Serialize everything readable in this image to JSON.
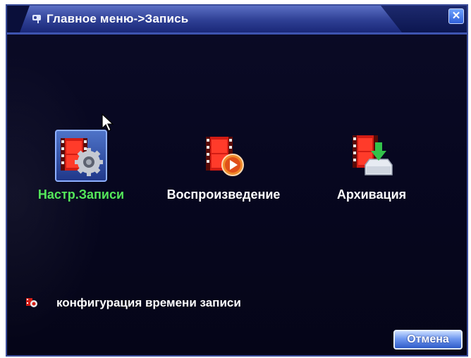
{
  "window": {
    "title": "Главное меню->Запись",
    "close_symbol": "✕"
  },
  "menu": {
    "items": [
      {
        "label": "Настр.Записи",
        "icon": "record-settings-icon",
        "selected": true
      },
      {
        "label": "Воспроизведение",
        "icon": "playback-icon",
        "selected": false
      },
      {
        "label": "Архивация",
        "icon": "backup-icon",
        "selected": false
      }
    ]
  },
  "hint": {
    "text": "конфигурация времени записи",
    "icon": "info-icon"
  },
  "footer": {
    "cancel_label": "Отмена"
  },
  "colors": {
    "background": "#070720",
    "title_bar": "#2e3f94",
    "selected_label": "#54e85a",
    "film_red": "#e02a1e"
  }
}
